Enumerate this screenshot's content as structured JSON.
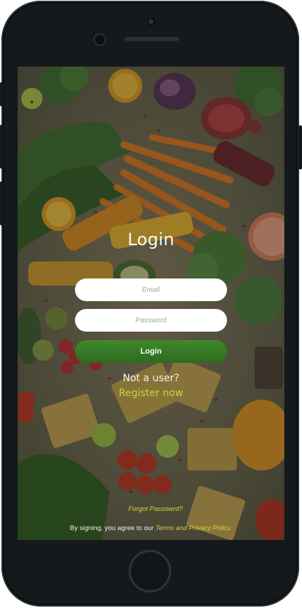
{
  "login": {
    "title": "Login",
    "email_placeholder": "Email",
    "password_placeholder": "Password",
    "submit_label": "Login",
    "not_user_text": "Not a user?",
    "register_link": "Register now",
    "forgot_password_link": "Forgot Passowrd?",
    "terms_prefix": "By signing, you agree to our ",
    "terms_link": "Terms and Privacy Policy."
  },
  "background": {
    "subject": "fresh vegetables and fruits on a wooden table",
    "items": [
      "carrots",
      "broccoli",
      "red cabbage",
      "pomegranate",
      "oranges",
      "grapefruit",
      "kidney beans",
      "avocado",
      "tomatoes",
      "juice bottles",
      "lime",
      "toast"
    ]
  },
  "colors": {
    "primary_button": "#3a7f26",
    "link_accent": "#d8d438",
    "device_frame": "#15191b"
  }
}
